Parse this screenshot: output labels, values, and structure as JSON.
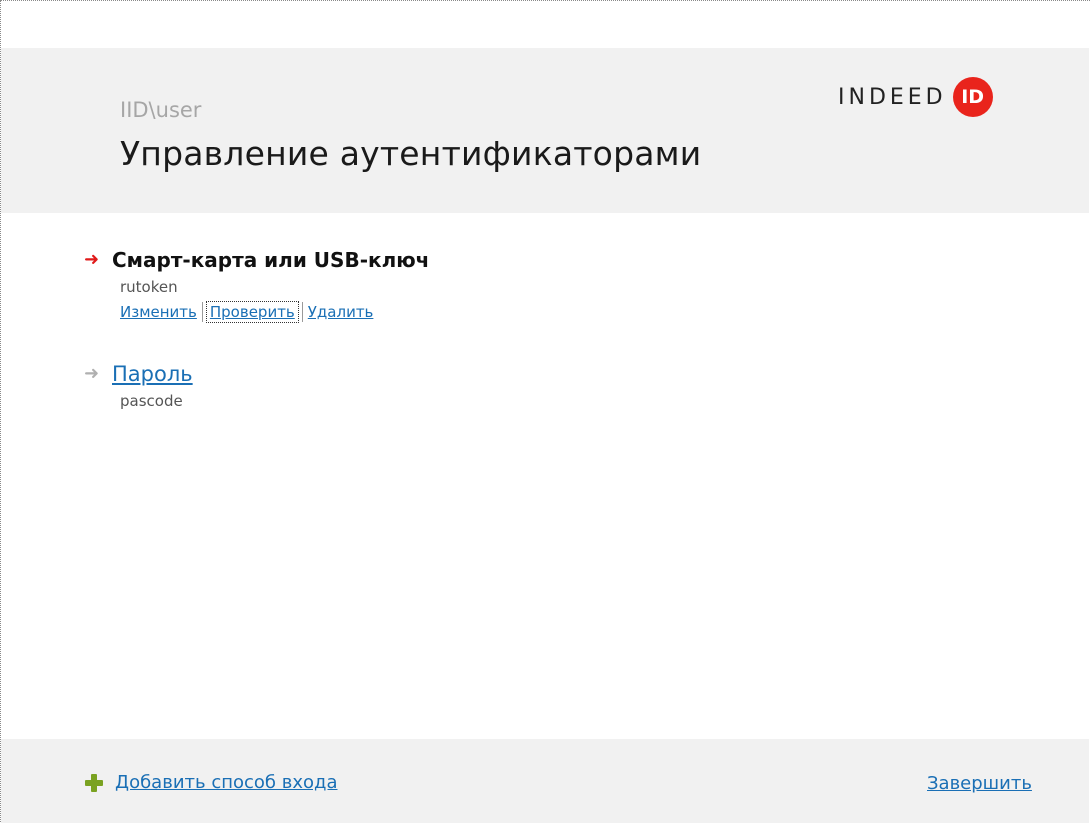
{
  "header": {
    "user": "IID\\user",
    "title": "Управление аутентификаторами",
    "logo": {
      "text": "INDEED",
      "badge": "ID",
      "accent_color": "#e9241c"
    }
  },
  "authenticators": [
    {
      "title": "Смарт-карта или USB-ключ",
      "subtitle": "rutoken",
      "active": true,
      "arrow_icon": "arrow-right-icon",
      "actions": [
        "Изменить",
        "Проверить",
        "Удалить"
      ]
    },
    {
      "title": "Пароль",
      "subtitle": "pascode",
      "active": false,
      "arrow_icon": "arrow-right-icon"
    }
  ],
  "footer": {
    "add_label": "Добавить способ входа",
    "add_icon": "plus-icon",
    "finish_label": "Завершить"
  },
  "colors": {
    "link": "#1a6fb5",
    "active_arrow": "#e01a1a",
    "inactive_arrow": "#b0b0b0",
    "plus": "#7aa221",
    "band": "#f1f1f1"
  }
}
